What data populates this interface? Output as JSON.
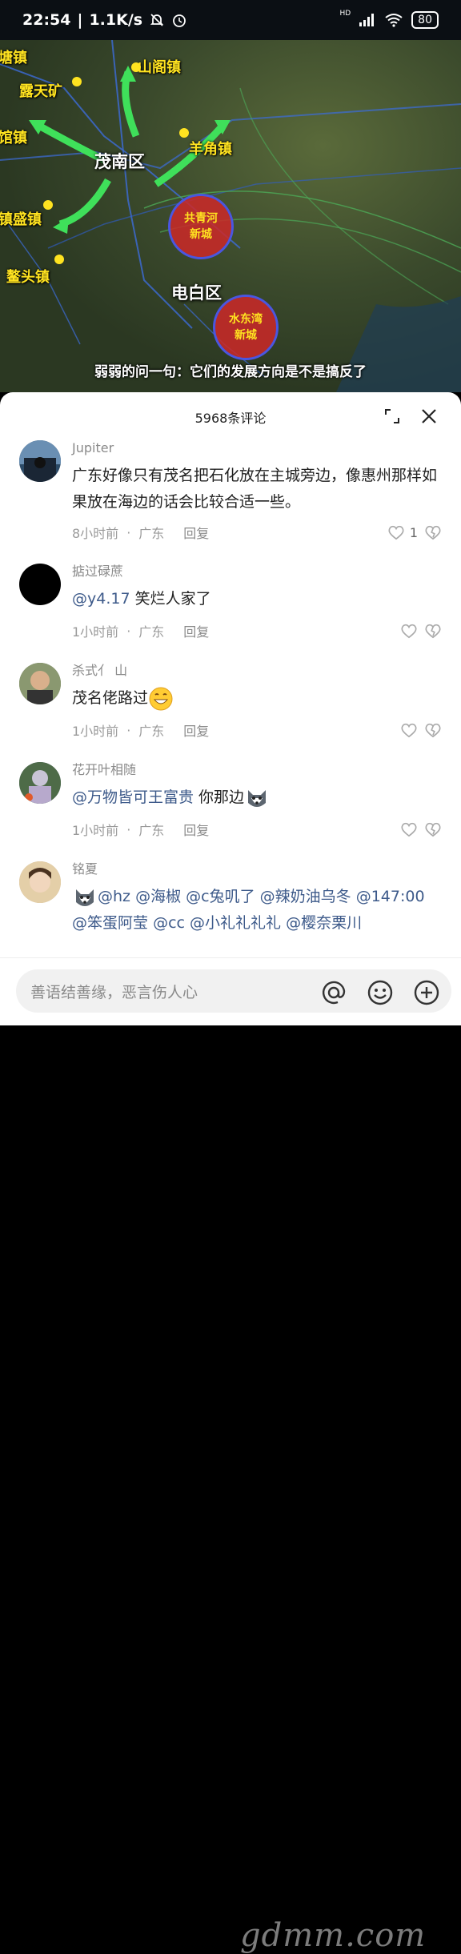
{
  "status_bar": {
    "time": "22:54",
    "speed": "1.1K/s",
    "battery": "80",
    "hd": "HD"
  },
  "video": {
    "caption": "弱弱的问一句：它们的发展方向是不是搞反了",
    "places": [
      "塘镇",
      "露天矿",
      "山阁镇",
      "馆镇",
      "羊角镇",
      "镇盛镇",
      "鳌头镇"
    ],
    "districts": [
      "茂南区",
      "电白区"
    ],
    "new_cities": [
      {
        "line1": "共青河",
        "line2": "新城"
      },
      {
        "line1": "水东湾",
        "line2": "新城"
      }
    ]
  },
  "comments_header": {
    "title": "5968条评论"
  },
  "comments": [
    {
      "name": "Jupiter",
      "text": "广东好像只有茂名把石化放在主城旁边，像惠州那样如果放在海边的话会比较合适一些。",
      "time": "8小时前",
      "region": "广东",
      "reply": "回复",
      "likes": "1"
    },
    {
      "name": "掂过碌蔗",
      "mention": "@y4.17",
      "text": " 笑烂人家了",
      "time": "1小时前",
      "region": "广东",
      "reply": "回复"
    },
    {
      "name": "杀式亻 山",
      "text": "茂名佬路过",
      "emoji": "grinning-emoji",
      "time": "1小时前",
      "region": "广东",
      "reply": "回复"
    },
    {
      "name": "花开叶相随",
      "mention": "@万物皆可王富贵",
      "text": " 你那边",
      "emoji": "husky-emoji",
      "time": "1小时前",
      "region": "广东",
      "reply": "回复"
    },
    {
      "name": "铭夏",
      "mentions": [
        "@hz",
        "@海椒",
        "@c兔叽了",
        "@辣奶油乌冬",
        "@147:00",
        "@笨蛋阿莹",
        "@cc",
        "@小礼礼礼礼",
        "@樱奈栗川"
      ],
      "emoji": "husky-emoji"
    }
  ],
  "input": {
    "placeholder": "善语结善缘，恶言伤人心"
  },
  "watermark": "gdmm.com",
  "colors": {
    "accent_link": "#3d5a8a",
    "place_label": "#ffe320",
    "new_city_fill": "#cd2828"
  }
}
